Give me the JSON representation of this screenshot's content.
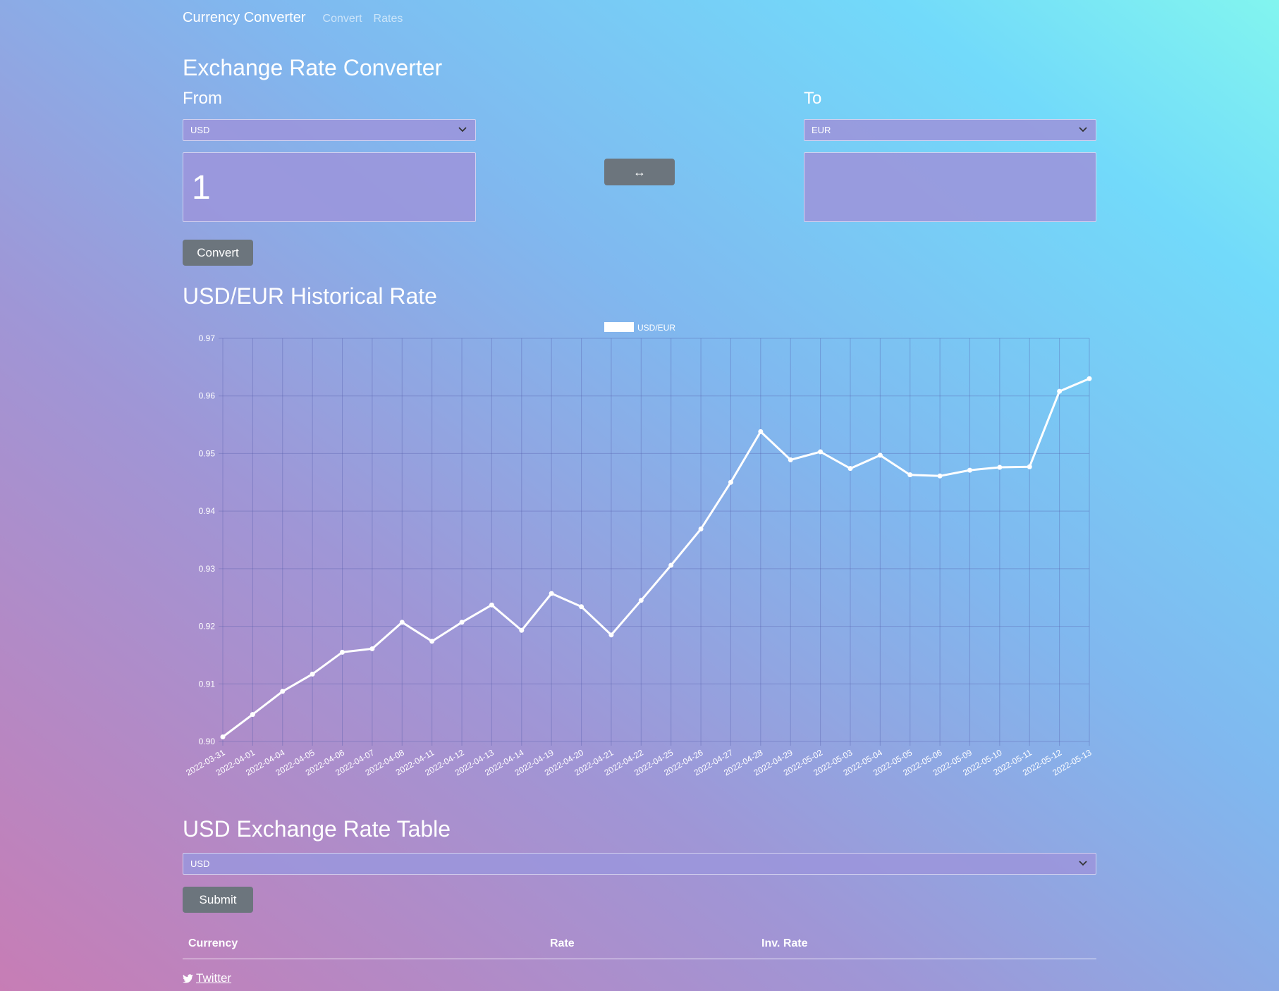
{
  "navbar": {
    "brand": "Currency Converter",
    "links": [
      "Convert",
      "Rates"
    ]
  },
  "converter": {
    "title": "Exchange Rate Converter",
    "from_label": "From",
    "to_label": "To",
    "from_currency": "USD",
    "to_currency": "EUR",
    "from_amount": "1",
    "to_amount": "",
    "swap_icon": "↔",
    "convert_label": "Convert"
  },
  "history": {
    "title": "USD/EUR Historical Rate"
  },
  "chart_data": {
    "type": "line",
    "legend": "top-center",
    "grid": true,
    "ylim": [
      0.9,
      0.97
    ],
    "yticks": [
      "0.97",
      "0.96",
      "0.95",
      "0.94",
      "0.93",
      "0.92",
      "0.91",
      "0.90"
    ],
    "x": [
      "2022-03-31",
      "2022-04-01",
      "2022-04-04",
      "2022-04-05",
      "2022-04-06",
      "2022-04-07",
      "2022-04-08",
      "2022-04-11",
      "2022-04-12",
      "2022-04-13",
      "2022-04-14",
      "2022-04-19",
      "2022-04-20",
      "2022-04-21",
      "2022-04-22",
      "2022-04-25",
      "2022-04-26",
      "2022-04-27",
      "2022-04-28",
      "2022-04-29",
      "2022-05-02",
      "2022-05-03",
      "2022-05-04",
      "2022-05-05",
      "2022-05-06",
      "2022-05-09",
      "2022-05-10",
      "2022-05-11",
      "2022-05-12",
      "2022-05-13"
    ],
    "series": [
      {
        "name": "USD/EUR",
        "values": [
          0.9008,
          0.9047,
          0.9087,
          0.9117,
          0.9155,
          0.9161,
          0.9207,
          0.9174,
          0.9207,
          0.9237,
          0.9193,
          0.9257,
          0.9234,
          0.9185,
          0.9245,
          0.9306,
          0.9369,
          0.945,
          0.9538,
          0.9489,
          0.9503,
          0.9474,
          0.9497,
          0.9463,
          0.9461,
          0.9471,
          0.9476,
          0.9477,
          0.9608,
          0.963
        ],
        "color": "#ffffff"
      }
    ]
  },
  "rate_table": {
    "title": "USD Exchange Rate Table",
    "base_currency": "USD",
    "submit_label": "Submit",
    "columns": [
      "Currency",
      "Rate",
      "Inv. Rate"
    ]
  },
  "footer": {
    "twitter_label": "Twitter",
    "twitter_icon": "twitter-icon"
  }
}
